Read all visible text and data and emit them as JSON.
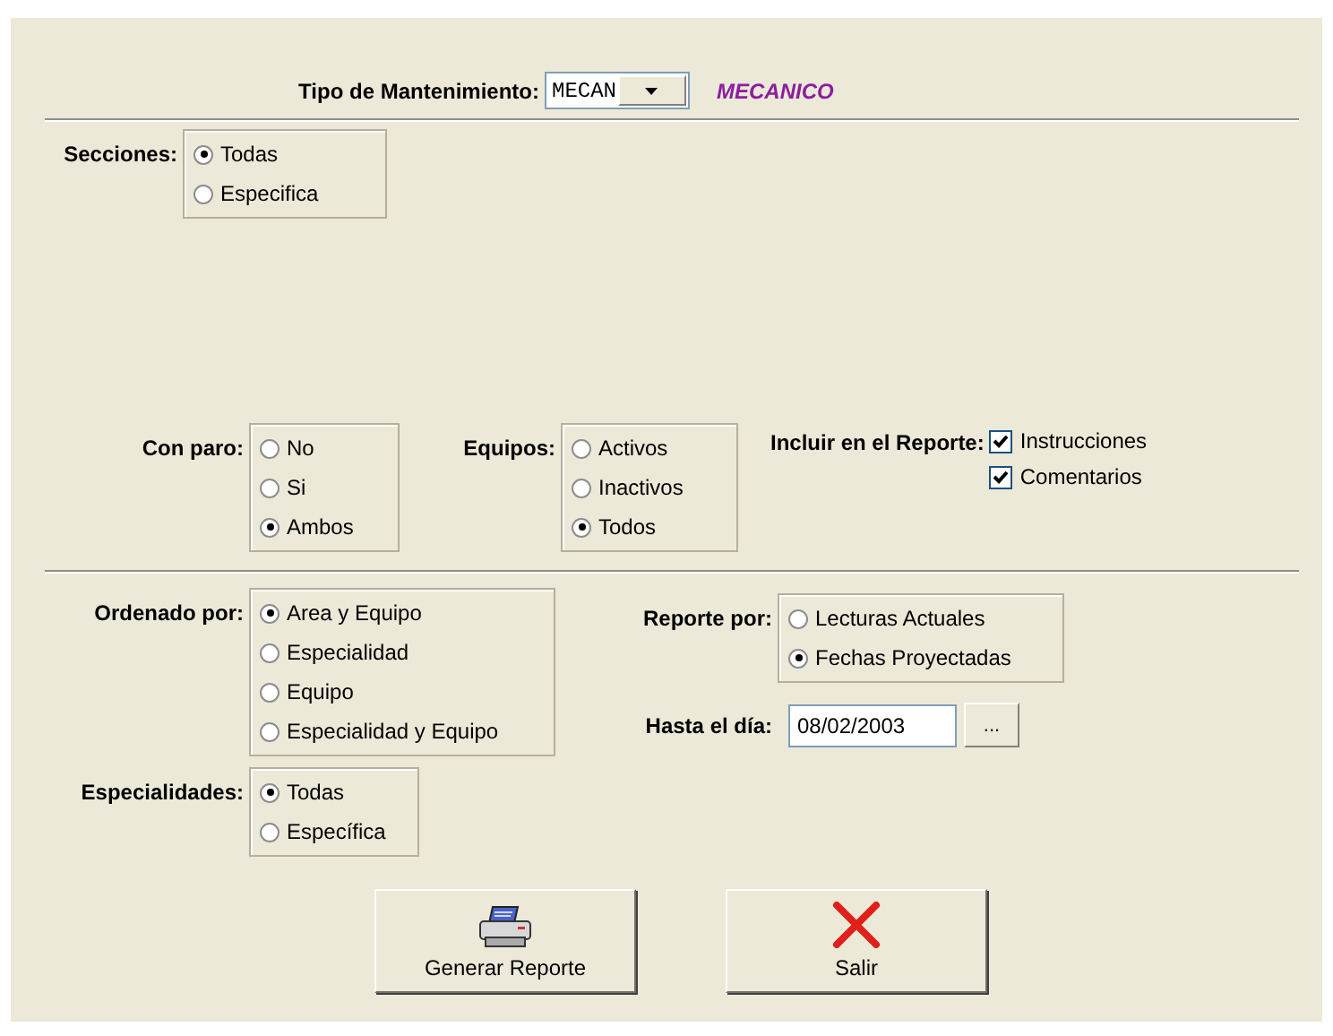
{
  "tipo": {
    "label": "Tipo de Mantenimiento:",
    "value": "MECAN",
    "description": "MECANICO"
  },
  "secciones": {
    "label": "Secciones:",
    "options": [
      {
        "label": "Todas",
        "selected": true
      },
      {
        "label": "Especifica",
        "selected": false
      }
    ]
  },
  "con_paro": {
    "label": "Con paro:",
    "options": [
      {
        "label": "No",
        "selected": false
      },
      {
        "label": "Si",
        "selected": false
      },
      {
        "label": "Ambos",
        "selected": true
      }
    ]
  },
  "equipos": {
    "label": "Equipos:",
    "options": [
      {
        "label": "Activos",
        "selected": false
      },
      {
        "label": "Inactivos",
        "selected": false
      },
      {
        "label": "Todos",
        "selected": true
      }
    ]
  },
  "incluir": {
    "label": "Incluir en el Reporte:",
    "items": [
      {
        "label": "Instrucciones",
        "checked": true
      },
      {
        "label": "Comentarios",
        "checked": true
      }
    ]
  },
  "ordenado_por": {
    "label": "Ordenado por:",
    "options": [
      {
        "label": "Area y Equipo",
        "selected": true
      },
      {
        "label": "Especialidad",
        "selected": false
      },
      {
        "label": "Equipo",
        "selected": false
      },
      {
        "label": "Especialidad y Equipo",
        "selected": false
      }
    ]
  },
  "reporte_por": {
    "label": "Reporte por:",
    "options": [
      {
        "label": "Lecturas Actuales",
        "selected": false
      },
      {
        "label": "Fechas Proyectadas",
        "selected": true
      }
    ]
  },
  "hasta_el_dia": {
    "label": "Hasta el día:",
    "value": "08/02/2003",
    "button": "..."
  },
  "especialidades": {
    "label": "Especialidades:",
    "options": [
      {
        "label": "Todas",
        "selected": true
      },
      {
        "label": "Específica",
        "selected": false
      }
    ]
  },
  "buttons": [
    {
      "label": "Generar Reporte",
      "kind": "print"
    },
    {
      "label": "Salir",
      "kind": "exit"
    }
  ]
}
